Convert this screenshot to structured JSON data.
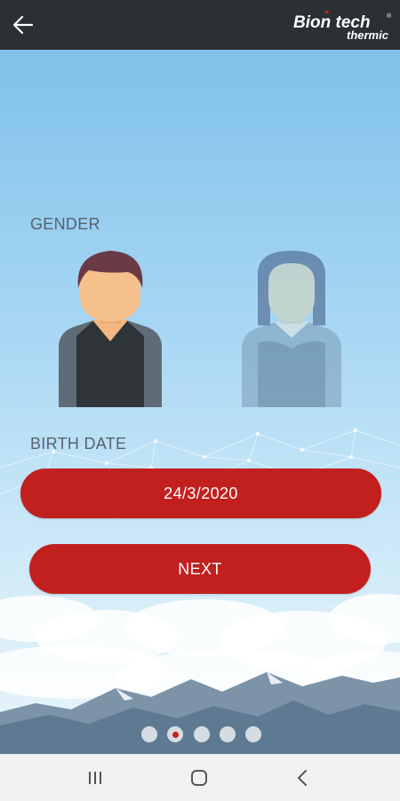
{
  "header": {
    "back_icon": "arrow-left-icon",
    "logo_text_main": "Bion tech",
    "logo_text_sub": "thermic",
    "logo_mark": "®"
  },
  "form": {
    "gender_label": "GENDER",
    "gender_options": [
      {
        "id": "male",
        "icon": "male-avatar-icon",
        "selected": true
      },
      {
        "id": "female",
        "icon": "female-avatar-icon",
        "selected": false
      }
    ],
    "birth_date_label": "BIRTH DATE",
    "birth_date_value": "24/3/2020",
    "next_label": "NEXT"
  },
  "pagination": {
    "total": 5,
    "active_index": 1
  },
  "system_nav": {
    "recent_icon": "recent-apps-icon",
    "home_icon": "home-icon",
    "back_icon": "nav-back-icon"
  },
  "colors": {
    "app_bar": "#2b3033",
    "accent": "#c2201f",
    "label": "#55636e",
    "sky_top": "#7fc1ea"
  }
}
